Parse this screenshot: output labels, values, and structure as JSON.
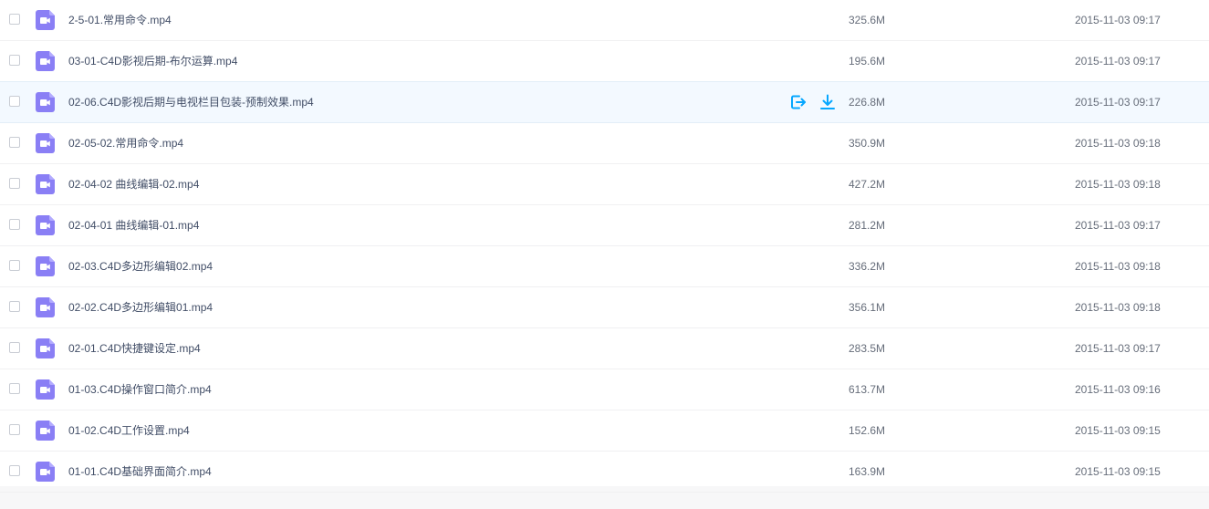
{
  "colors": {
    "accent": "#06a7ff",
    "video_icon": "#8a7ff5",
    "hover_row": "#f3f9ff"
  },
  "row_actions": {
    "share_icon": "share-out-icon",
    "download_icon": "download-icon"
  },
  "files": [
    {
      "name": "2-5-01.常用命令.mp4",
      "size": "325.6M",
      "date": "2015-11-03 09:17"
    },
    {
      "name": "03-01-C4D影视后期-布尔运算.mp4",
      "size": "195.6M",
      "date": "2015-11-03 09:17"
    },
    {
      "name": "02-06.C4D影视后期与电视栏目包装-预制效果.mp4",
      "size": "226.8M",
      "date": "2015-11-03 09:17",
      "hovered": true
    },
    {
      "name": "02-05-02.常用命令.mp4",
      "size": "350.9M",
      "date": "2015-11-03 09:18"
    },
    {
      "name": "02-04-02 曲线编辑-02.mp4",
      "size": "427.2M",
      "date": "2015-11-03 09:18"
    },
    {
      "name": "02-04-01 曲线编辑-01.mp4",
      "size": "281.2M",
      "date": "2015-11-03 09:17"
    },
    {
      "name": "02-03.C4D多边形编辑02.mp4",
      "size": "336.2M",
      "date": "2015-11-03 09:18"
    },
    {
      "name": "02-02.C4D多边形编辑01.mp4",
      "size": "356.1M",
      "date": "2015-11-03 09:18"
    },
    {
      "name": "02-01.C4D快捷键设定.mp4",
      "size": "283.5M",
      "date": "2015-11-03 09:17"
    },
    {
      "name": "01-03.C4D操作窗口简介.mp4",
      "size": "613.7M",
      "date": "2015-11-03 09:16"
    },
    {
      "name": "01-02.C4D工作设置.mp4",
      "size": "152.6M",
      "date": "2015-11-03 09:15"
    },
    {
      "name": "01-01.C4D基础界面简介.mp4",
      "size": "163.9M",
      "date": "2015-11-03 09:15"
    }
  ]
}
